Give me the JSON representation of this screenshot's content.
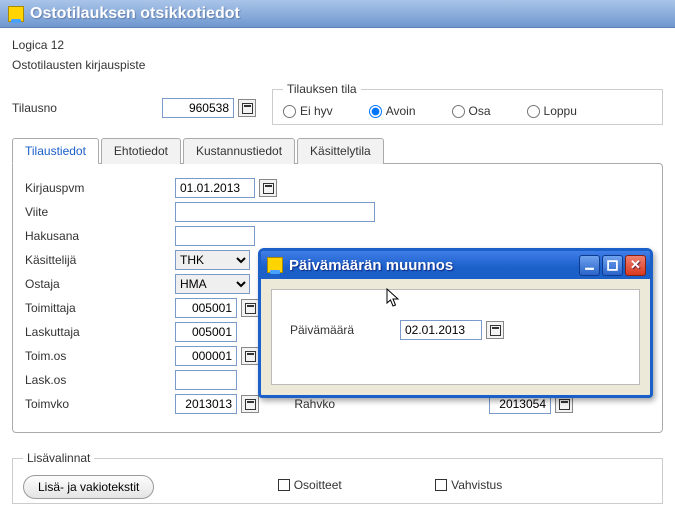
{
  "window": {
    "title": "Ostotilauksen otsikkotiedot"
  },
  "info": {
    "company": "Logica 12",
    "subtitle": "Ostotilausten kirjauspiste"
  },
  "order_no": {
    "label": "Tilausno",
    "value": "960538"
  },
  "status": {
    "legend": "Tilauksen tila",
    "options": {
      "eihyv": "Ei hyv",
      "avoin": "Avoin",
      "osa": "Osa",
      "loppu": "Loppu"
    },
    "selected": "avoin"
  },
  "tabs": {
    "tilaustiedot": "Tilaustiedot",
    "ehtotiedot": "Ehtotiedot",
    "kustannustiedot": "Kustannustiedot",
    "kasittelytila": "Käsittelytila"
  },
  "fields": {
    "kirjauspvm": {
      "label": "Kirjauspvm",
      "value": "01.01.2013"
    },
    "viite": {
      "label": "Viite",
      "value": ""
    },
    "hakusana": {
      "label": "Hakusana",
      "value": ""
    },
    "kasittelija": {
      "label": "Käsittelijä",
      "value": "THK"
    },
    "ostaja": {
      "label": "Ostaja",
      "value": "HMA"
    },
    "toimittaja": {
      "label": "Toimittaja",
      "value": "005001"
    },
    "laskuttaja": {
      "label": "Laskuttaja",
      "value": "005001"
    },
    "toimos": {
      "label": "Toim.os",
      "value": "000001"
    },
    "laskos": {
      "label": "Lask.os",
      "value": ""
    },
    "toimvko": {
      "label": "Toimvko",
      "value": "2013013"
    },
    "rahvko": {
      "label": "Rahvko",
      "value": "2013054"
    }
  },
  "extras": {
    "legend": "Lisävalinnat",
    "button": "Lisä- ja vakiotekstit",
    "osoitteet": "Osoitteet",
    "vahvistus": "Vahvistus"
  },
  "dialog": {
    "title": "Päivämäärän muunnos",
    "field_label": "Päivämäärä",
    "field_value": "02.01.2013"
  }
}
